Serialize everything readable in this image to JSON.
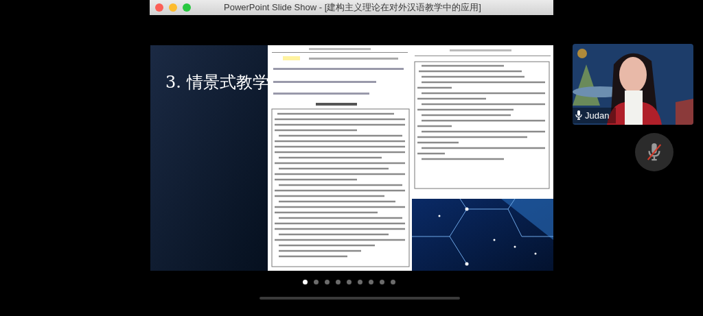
{
  "window": {
    "title": "PowerPoint Slide Show - [建构主义理论在对外汉语教学中的应用]"
  },
  "slide": {
    "heading": "3. 情景式教学"
  },
  "participant": {
    "name": "Judan",
    "mic_muted": false
  },
  "mute_button": {
    "muted": true
  },
  "pages": [
    {
      "selected": true
    },
    {
      "selected": false
    },
    {
      "selected": false
    },
    {
      "selected": false
    },
    {
      "selected": false
    },
    {
      "selected": false
    },
    {
      "selected": false
    },
    {
      "selected": false
    },
    {
      "selected": false
    }
  ]
}
